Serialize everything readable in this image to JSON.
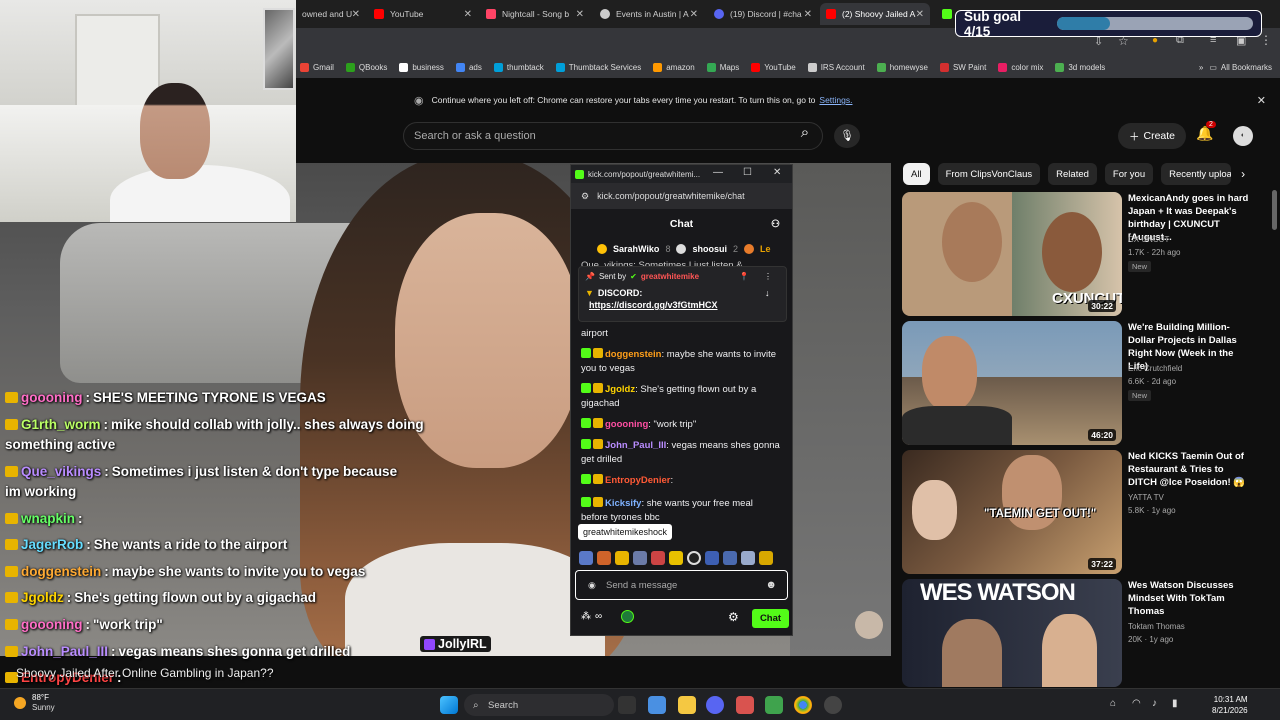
{
  "browser": {
    "tabs": [
      {
        "label": "owned and U",
        "color": "#777777"
      },
      {
        "label": "YouTube",
        "color": "#ff0000"
      },
      {
        "label": "Nightcall - Song b",
        "color": "#ff4466"
      },
      {
        "label": "Events in Austin | A",
        "color": "#cccccc"
      },
      {
        "label": "(19) Discord | #cha",
        "color": "#5865f2"
      },
      {
        "label": "(2) Shoovy Jailed A",
        "color": "#ff0000"
      }
    ],
    "bookmarks": [
      {
        "label": "Gmail",
        "color": "#ea4335"
      },
      {
        "label": "QBooks",
        "color": "#2ca01c"
      },
      {
        "label": "business",
        "color": "#ffffff"
      },
      {
        "label": "ads",
        "color": "#4285f4"
      },
      {
        "label": "thumbtack",
        "color": "#009fd9"
      },
      {
        "label": "Thumbtack Services",
        "color": "#009fd9"
      },
      {
        "label": "amazon",
        "color": "#ff9900"
      },
      {
        "label": "Maps",
        "color": "#34a853"
      },
      {
        "label": "YouTube",
        "color": "#ff0000"
      },
      {
        "label": "IRS Account",
        "color": "#cccccc"
      },
      {
        "label": "homewyse",
        "color": "#4caf50"
      },
      {
        "label": "SW Paint",
        "color": "#d32f2f"
      },
      {
        "label": "color mix",
        "color": "#e91e63"
      },
      {
        "label": "3d models",
        "color": "#4caf50"
      }
    ],
    "all_bookmarks": "All Bookmarks",
    "restore_text": "Continue where you left off: Chrome can restore your tabs every time you restart. To turn this on, go to",
    "restore_link": "Settings."
  },
  "sub_goal": {
    "label": "Sub goal 4/15",
    "progress": 0.27
  },
  "youtube": {
    "search_placeholder": "Search or ask a question",
    "create_label": "Create",
    "notif_count": "2",
    "chips": [
      "All",
      "From ClipsVonClaus",
      "Related",
      "For you",
      "Recently uploa"
    ],
    "videos": [
      {
        "title": "MexicanAndy goes in hard Japan + It was Deepak's birthday | CXUNCUT [August...",
        "channel": "CX UNCUT",
        "meta": "1.7K · 22h ago",
        "badge": "New",
        "duration": "30:22",
        "thumb_text": "CXUNCUT",
        "thumb_color": "#b99a7a"
      },
      {
        "title": "We're Building Million-Dollar Projects in Dallas Right Now (Week in the Life)",
        "channel": "Eric Crutchfield",
        "meta": "6.6K · 2d ago",
        "badge": "New",
        "duration": "46:20",
        "thumb_text": "",
        "thumb_color": "#7a8ea6"
      },
      {
        "title": "Ned KICKS Taemin Out of Restaurant & Tries to DITCH @Ice Poseidon! 😱",
        "channel": "YATTA TV",
        "meta": "5.8K · 1y ago",
        "badge": "",
        "duration": "37:22",
        "thumb_text": "\"TAEMIN GET OUT!\"",
        "thumb_color": "#6b5040"
      },
      {
        "title": "Wes Watson Discusses Mindset With TokTam Thomas",
        "channel": "Toktam Thomas",
        "meta": "20K · 1y ago",
        "badge": "",
        "duration": "",
        "thumb_text": "WES WATSON",
        "thumb_color": "#2a2f3a"
      }
    ]
  },
  "overlay_chat": [
    {
      "user": "goooning",
      "text": "SHE'S MEETING TYRONE IS VEGAS",
      "color": "#ff6ec7"
    },
    {
      "user": "G1rth_worm",
      "text": "mike should collab with jolly.. shes always doing",
      "color": "#bbff66"
    },
    {
      "user": "",
      "text": "something active",
      "color": "#ffffff"
    },
    {
      "user": "Que_vikings",
      "text": "Sometimes i just listen & don't type because",
      "color": "#b98cff"
    },
    {
      "user": "",
      "text": "im working",
      "color": "#ffffff"
    },
    {
      "user": "wnapkin",
      "text": "",
      "color": "#66ff66"
    },
    {
      "user": "JagerRob",
      "text": "She wants a ride to the airport",
      "color": "#66ddff"
    },
    {
      "user": "doggenstein",
      "text": "maybe she wants to invite you to vegas",
      "color": "#ffaa33"
    },
    {
      "user": "Jgoldz",
      "text": "She's getting flown out by a gigachad",
      "color": "#ffd400"
    },
    {
      "user": "goooning",
      "text": "\"work trip\"",
      "color": "#ff6ec7"
    },
    {
      "user": "John_Paul_III",
      "text": "vegas means shes gonna get drilled",
      "color": "#b98cff"
    },
    {
      "user": "EntropyDenier",
      "text": "",
      "color": "#ff4444"
    }
  ],
  "jolly_tag": "JollyIRL",
  "video_title": "Shoovy Jailed After Online Gambling in Japan??",
  "popout": {
    "window_title": "kick.com/popout/greatwhitemi...",
    "url": "kick.com/popout/greatwhitemike/chat",
    "header": "Chat",
    "gifters": [
      {
        "name": "SarahWiko",
        "count": "8"
      },
      {
        "name": "shoosui",
        "count": "2"
      },
      {
        "name": "Le",
        "count": ""
      }
    ],
    "partial_line": "Que_vikings: Sometimes I just listen &",
    "pinned": {
      "sent_by": "Sent by",
      "sender": "greatwhitemike",
      "label": "DISCORD:",
      "link": "https://discord.gg/v3fGtmHCX"
    },
    "messages": [
      {
        "user": "",
        "text": "airport",
        "color": "#ffffff"
      },
      {
        "user": "doggenstein",
        "text": "maybe she wants to invite you to vegas",
        "color": "#ff9f1a"
      },
      {
        "user": "Jgoldz",
        "text": "She's getting flown out by a gigachad",
        "color": "#ffd400"
      },
      {
        "user": "goooning",
        "text": "\"work trip\"",
        "color": "#ff4fa3"
      },
      {
        "user": "John_Paul_III",
        "text": "vegas means shes gonna get drilled",
        "color": "#b98cff"
      },
      {
        "user": "EntropyDenier",
        "text": "",
        "color": "#ff5a36"
      },
      {
        "user": "Kicksify",
        "text": "she wants your free meal before tyrones bbc",
        "color": "#7fb2ff"
      }
    ],
    "tooltip": "greatwhitemikeshock",
    "placeholder": "Send a message",
    "chat_button": "Chat"
  },
  "taskbar": {
    "temp": "88°F",
    "condition": "Sunny",
    "search": "Search",
    "time": "10:31 AM",
    "date": "8/21/2026"
  }
}
